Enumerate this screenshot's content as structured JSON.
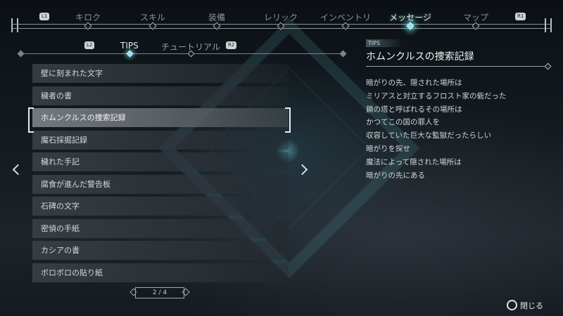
{
  "top_tabs": {
    "left_button": "L1",
    "right_button": "R1",
    "items": [
      {
        "label": "キロク",
        "active": false
      },
      {
        "label": "スキル",
        "active": false
      },
      {
        "label": "装備",
        "active": false
      },
      {
        "label": "レリック",
        "active": false
      },
      {
        "label": "インベントリ",
        "active": false
      },
      {
        "label": "メッセージ",
        "active": true
      },
      {
        "label": "マップ",
        "active": false
      }
    ]
  },
  "sub_tabs": {
    "left_button": "L2",
    "right_button": "R2",
    "items": [
      {
        "label": "TIPS",
        "active": true
      },
      {
        "label": "チュートリアル",
        "active": false
      }
    ]
  },
  "list": {
    "selected_index": 2,
    "items": [
      "壁に刻まれた文字",
      "穢者の書",
      "ホムンクルスの捜索記録",
      "魔石採掘記録",
      "穢れた手記",
      "腐食が進んだ警告板",
      "石碑の文字",
      "密偵の手紙",
      "カシアの書",
      "ボロボロの貼り紙"
    ]
  },
  "pager": {
    "label": "2 / 4"
  },
  "detail": {
    "category": "TIPS",
    "title": "ホムンクルスの捜索記録",
    "lines": [
      "暗がりの先、隠された場所は",
      "ミリアスと対立するフロスト家の砦だった",
      "鎖の塔と呼ばれるその場所は",
      "かつてこの国の罪人を",
      "収容していた巨大な監獄だったらしい",
      "暗がりを探せ",
      "魔法によって隠された場所は",
      "暗がりの先にある"
    ]
  },
  "footer": {
    "close_label": "閉じる",
    "close_icon": "circle-button-icon"
  },
  "colors": {
    "accent": "#8fe3ec",
    "selected_row": "#7e848a"
  }
}
